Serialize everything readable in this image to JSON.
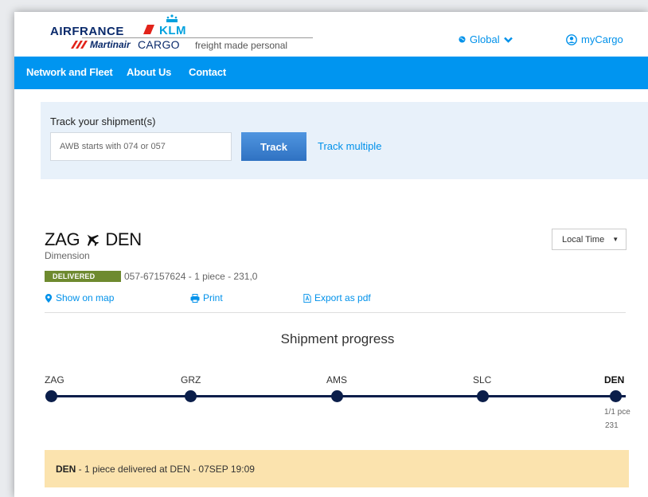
{
  "header": {
    "logo": {
      "airfrance": "AIRFRANCE",
      "klm": "KLM",
      "martinair": "Martinair",
      "cargo": "CARGO",
      "tagline": "freight made personal"
    },
    "region_label": "Global",
    "account_label": "myCargo"
  },
  "nav": {
    "items": [
      {
        "label": "Network and Fleet"
      },
      {
        "label": "About Us"
      },
      {
        "label": "Contact"
      }
    ]
  },
  "track": {
    "label": "Track your shipment(s)",
    "input_placeholder": "AWB starts with 074 or 057",
    "input_value": "",
    "button_label": "Track",
    "multiple_link": "Track multiple"
  },
  "shipment": {
    "origin": "ZAG",
    "destination": "DEN",
    "subtitle": "Dimension",
    "status_badge": "DELIVERED",
    "summary": "057-67157624 - 1 piece - 231,0",
    "time_select": "Local Time",
    "actions": {
      "show_on_map": "Show on map",
      "print": "Print",
      "export_pdf": "Export as pdf"
    }
  },
  "progress": {
    "title": "Shipment progress",
    "stops": [
      {
        "code": "ZAG",
        "current": false
      },
      {
        "code": "GRZ",
        "current": false
      },
      {
        "code": "AMS",
        "current": false
      },
      {
        "code": "SLC",
        "current": false
      },
      {
        "code": "DEN",
        "current": true,
        "pieces": "1/1 pce",
        "weight": "231"
      }
    ]
  },
  "delivered_banner": {
    "station": "DEN",
    "text": " - 1 piece delivered at DEN - 07SEP 19:09"
  },
  "colors": {
    "nav_blue": "#0095f0",
    "link_blue": "#0091ea",
    "navy": "#0b1e4a",
    "delivered_green": "#6e8a2f",
    "banner_yellow": "#fbe3ae",
    "panel_blue": "#e8f1fa"
  }
}
